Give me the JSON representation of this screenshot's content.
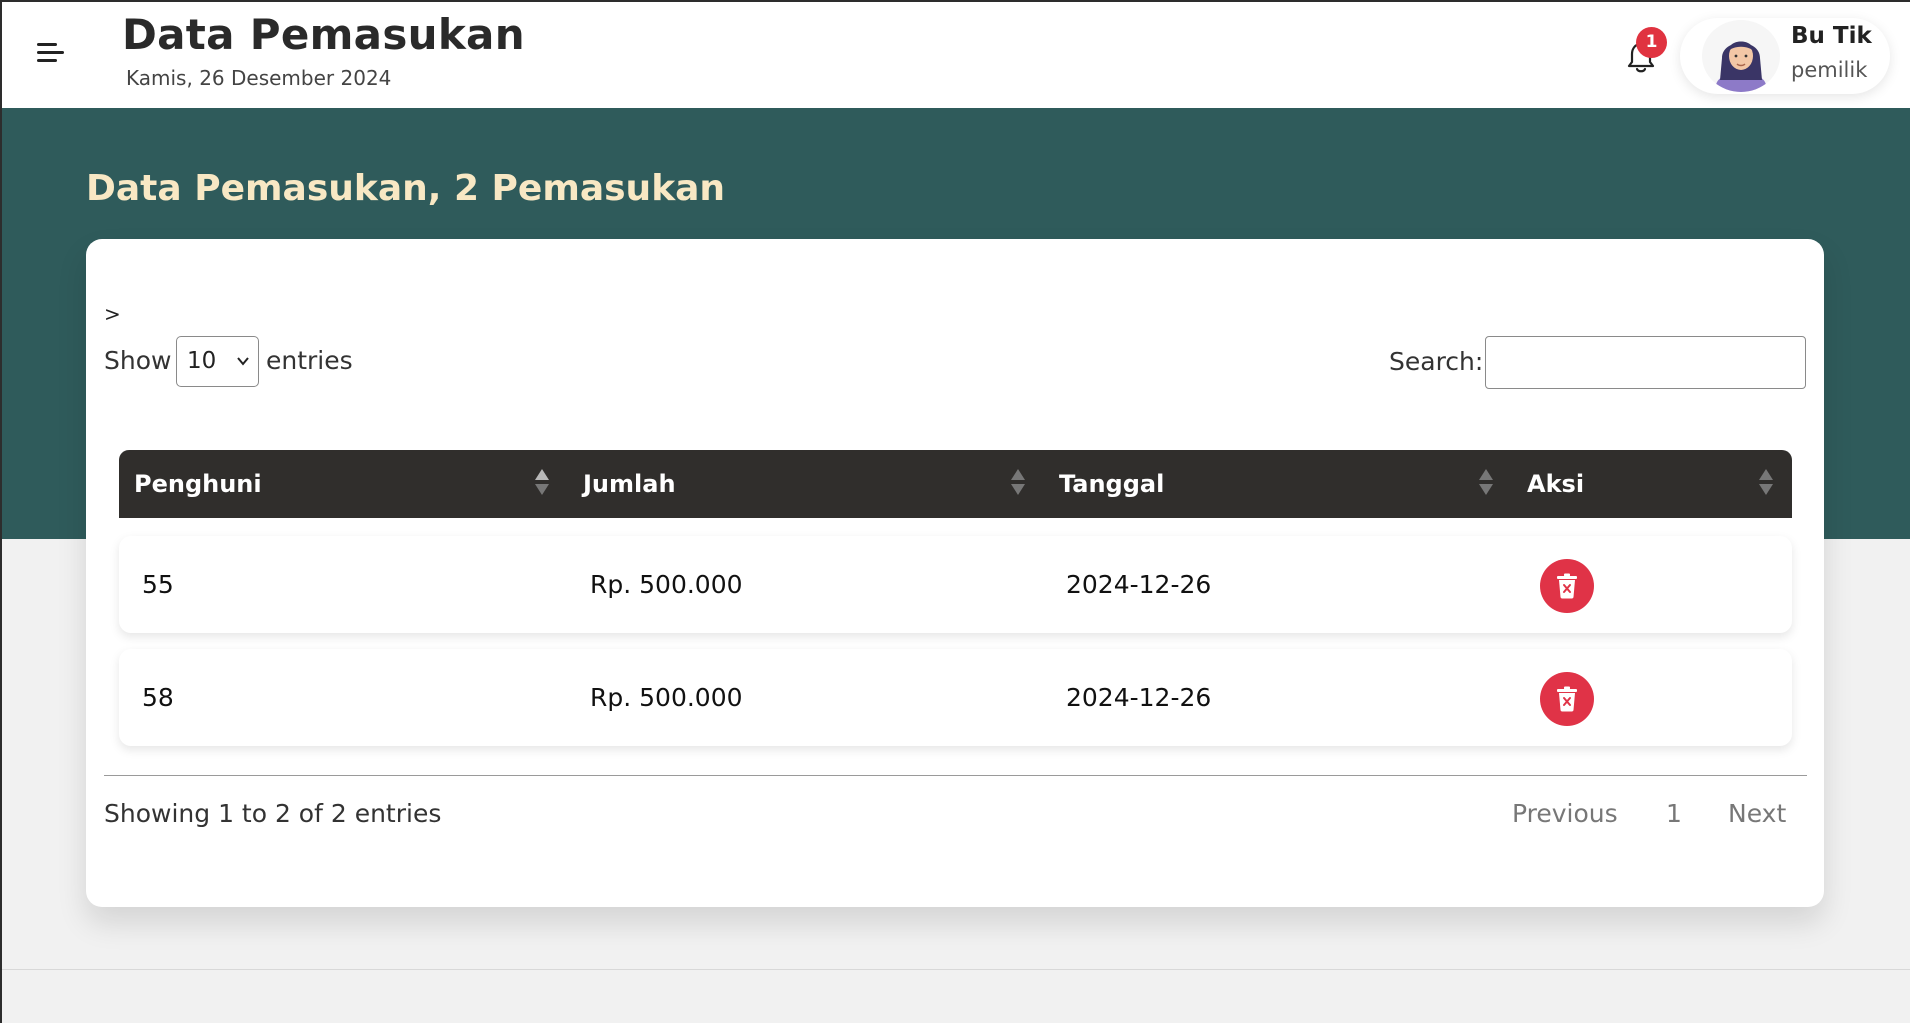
{
  "header": {
    "title": "Data Pemasukan",
    "date": "Kamis, 26 Desember 2024",
    "notification_count": "1",
    "user": {
      "name": "Bu Tik",
      "role": "pemilik"
    }
  },
  "section": {
    "title": "Data Pemasukan, 2 Pemasukan"
  },
  "table_controls": {
    "chevron": ">",
    "show_label": "Show",
    "entries_label": "entries",
    "length_value": "10",
    "search_label": "Search:",
    "search_value": "",
    "search_placeholder": ""
  },
  "table": {
    "columns": [
      "Penghuni",
      "Jumlah",
      "Tanggal",
      "Aksi"
    ],
    "rows": [
      {
        "penghuni": "55",
        "jumlah": "Rp. 500.000",
        "tanggal": "2024-12-26"
      },
      {
        "penghuni": "58",
        "jumlah": "Rp. 500.000",
        "tanggal": "2024-12-26"
      }
    ]
  },
  "footer": {
    "info": "Showing 1 to 2 of 2 entries",
    "previous": "Previous",
    "page": "1",
    "next": "Next"
  },
  "colors": {
    "hero": "#2f5b5b",
    "title_accent": "#f8e8c4",
    "table_head": "#302e2c",
    "danger": "#e03347"
  },
  "icons": {
    "menu": "hamburger-menu-icon",
    "bell": "bell-icon",
    "delete": "trash-x-icon",
    "sort": "sort-arrows-icon"
  }
}
